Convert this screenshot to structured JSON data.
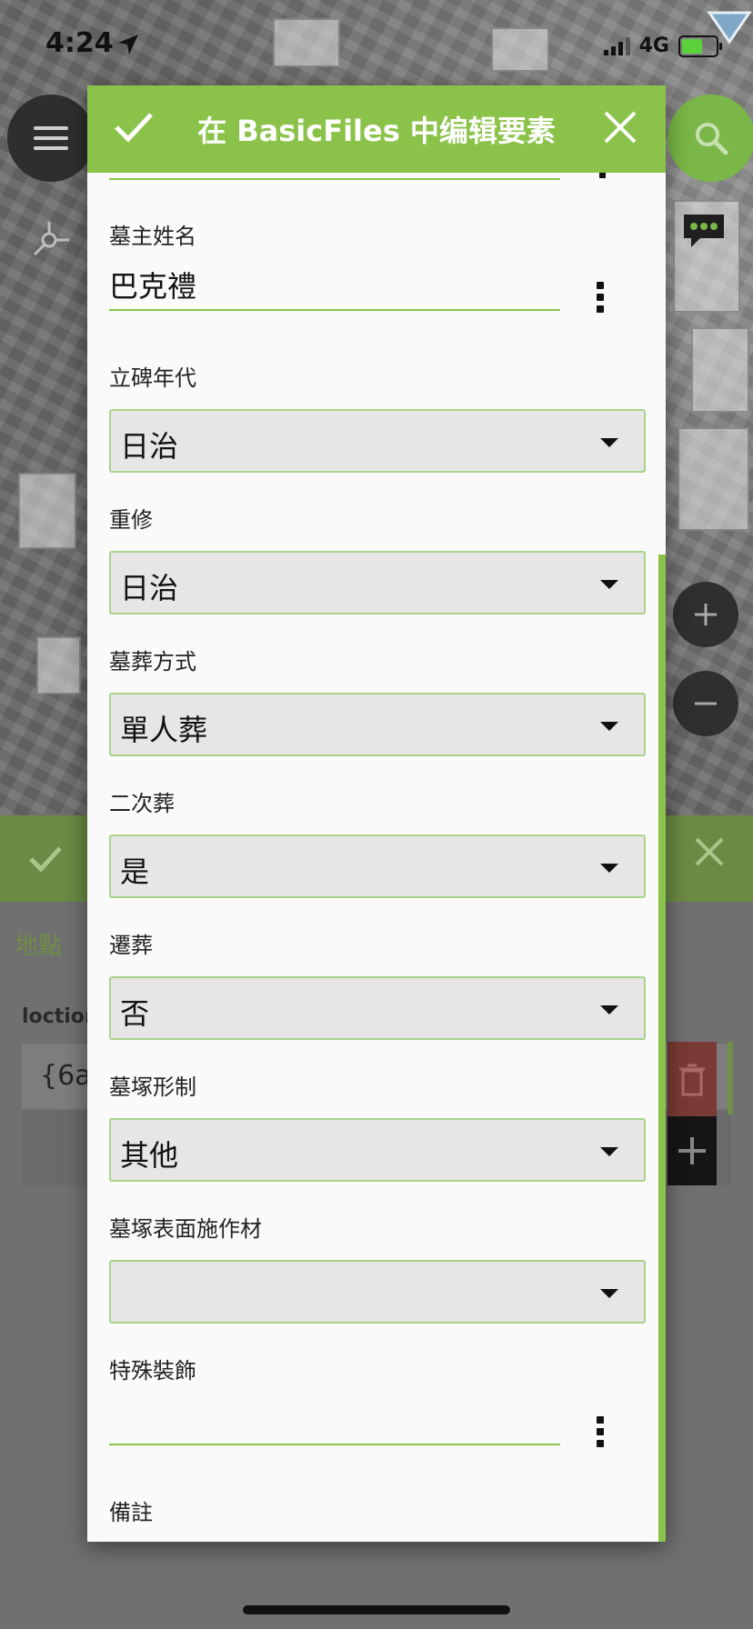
{
  "status_bar": {
    "time": "4:24",
    "network": "4G"
  },
  "dialog": {
    "title": "在 BasicFiles 中编辑要素",
    "fields": {
      "owner_name": {
        "label": "墓主姓名",
        "value": "巴克禮"
      },
      "erected_era": {
        "label": "立碑年代",
        "value": "日治"
      },
      "renovated": {
        "label": "重修",
        "value": "日治"
      },
      "burial_method": {
        "label": "墓葬方式",
        "value": "單人葬"
      },
      "secondary_burial": {
        "label": "二次葬",
        "value": "是"
      },
      "relocated": {
        "label": "遷葬",
        "value": "否"
      },
      "tomb_form": {
        "label": "墓塚形制",
        "value": "其他"
      },
      "surface_material": {
        "label": "墓塚表面施作材",
        "value": ""
      },
      "special_decoration": {
        "label": "特殊裝飾",
        "value": ""
      },
      "remarks": {
        "label": "備註"
      }
    }
  },
  "background_form": {
    "tab_label": "地點",
    "field_label": "loction",
    "field_value": "{6a"
  }
}
